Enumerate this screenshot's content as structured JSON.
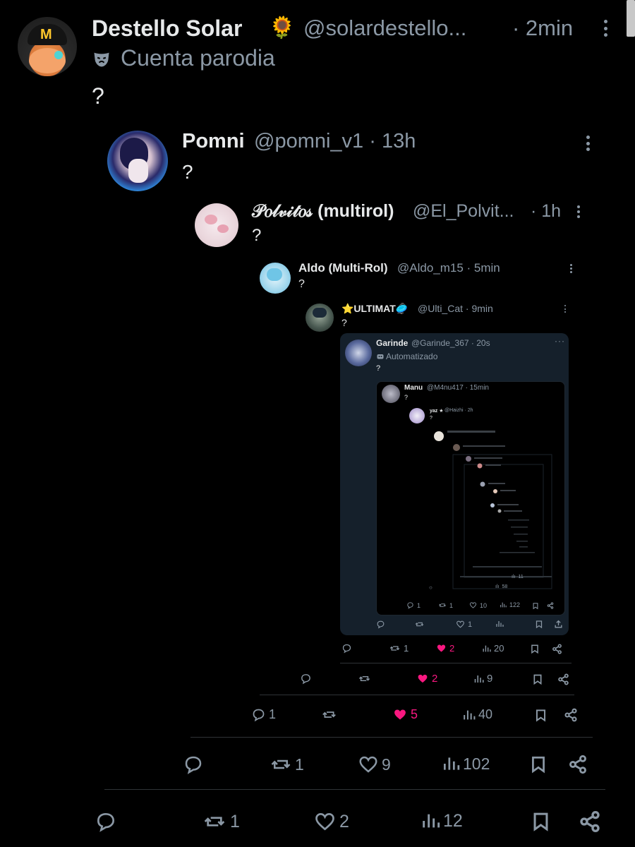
{
  "colors": {
    "background": "#000000",
    "text": "#e7e9ea",
    "secondary": "#8b98a5",
    "like_pink": "#f91880",
    "card_bg": "#15202b"
  },
  "main_post": {
    "display_name": "Destello Solar",
    "emoji": "🌻",
    "handle": "@solardestello...",
    "time": "· 2min",
    "badge_label": "Cuenta parodia",
    "badge_icon": "mask-icon",
    "text": "?",
    "actions": {
      "reply": "",
      "repost": "1",
      "like": "2",
      "views": "12"
    }
  },
  "reply1": {
    "display_name": "Pomni",
    "handle": "@pomni_v1 · 13h",
    "text": "?",
    "actions": {
      "reply": "",
      "repost": "1",
      "like": "9",
      "views": "102"
    }
  },
  "reply2": {
    "display_name": "𝒫𝑜𝓁𝓋𝒾𝓉𝑜𝓈 (multirol)",
    "handle": "@El_Polvit...",
    "time": "· 1h",
    "text": "?",
    "actions": {
      "reply": "1",
      "repost": "",
      "like": "5",
      "views": "40"
    }
  },
  "reply3": {
    "display_name": "Aldo (Multi-Rol)",
    "handle": "@Aldo_m15 · 5min",
    "text": "?",
    "actions": {
      "reply": "",
      "repost": "",
      "like": "2",
      "views": "9"
    }
  },
  "reply4": {
    "display_name": "⭐ULTIMAT🥏",
    "handle": "@Ulti_Cat · 9min",
    "text": "?",
    "actions": {
      "reply": "",
      "repost": "1",
      "like": "2",
      "views": "20"
    }
  },
  "card": {
    "display_name": "Garinde",
    "handle": "@Garinde_367 · 20s",
    "badge_label": "Automatizado",
    "badge_icon": "robot-icon",
    "text": "?",
    "actions": {
      "reply": "",
      "repost": "",
      "like": "1",
      "views": ""
    }
  },
  "inner": {
    "display_name": "Manu",
    "handle": "@M4nu417 · 15min",
    "text": "?",
    "nested_name": "yaz ★",
    "nested_handle": "@Haizhi · 2h",
    "nested_text": "?",
    "actions": {
      "reply": "1",
      "repost": "1",
      "like": "10",
      "views": "122"
    },
    "actions2": {
      "reply": "",
      "repost": "",
      "like": "1",
      "views": "58"
    },
    "actions3": {
      "reply": "",
      "repost": "",
      "like": "",
      "views": "11"
    }
  }
}
